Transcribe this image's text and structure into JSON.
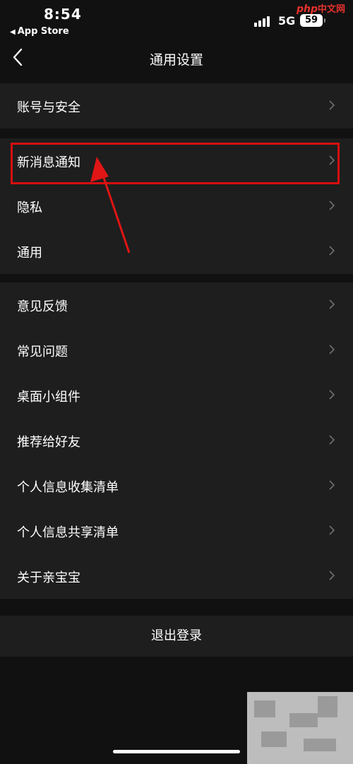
{
  "status": {
    "time": "8:54",
    "back_app": "App Store",
    "network": "5G",
    "battery": "59"
  },
  "watermark": {
    "brand": "php",
    "site": "中文网"
  },
  "nav": {
    "title": "通用设置"
  },
  "groups": [
    {
      "items": [
        "账号与安全"
      ]
    },
    {
      "items": [
        "新消息通知",
        "隐私",
        "通用"
      ]
    },
    {
      "items": [
        "意见反馈",
        "常见问题",
        "桌面小组件",
        "推荐给好友",
        "个人信息收集清单",
        "个人信息共享清单",
        "关于亲宝宝"
      ]
    }
  ],
  "logout": {
    "label": "退出登录"
  },
  "colors": {
    "background": "#111111",
    "card": "#1e1e1e",
    "text": "#ffffff",
    "chevron": "#6f6f6f",
    "highlight": "#d60f0f"
  }
}
